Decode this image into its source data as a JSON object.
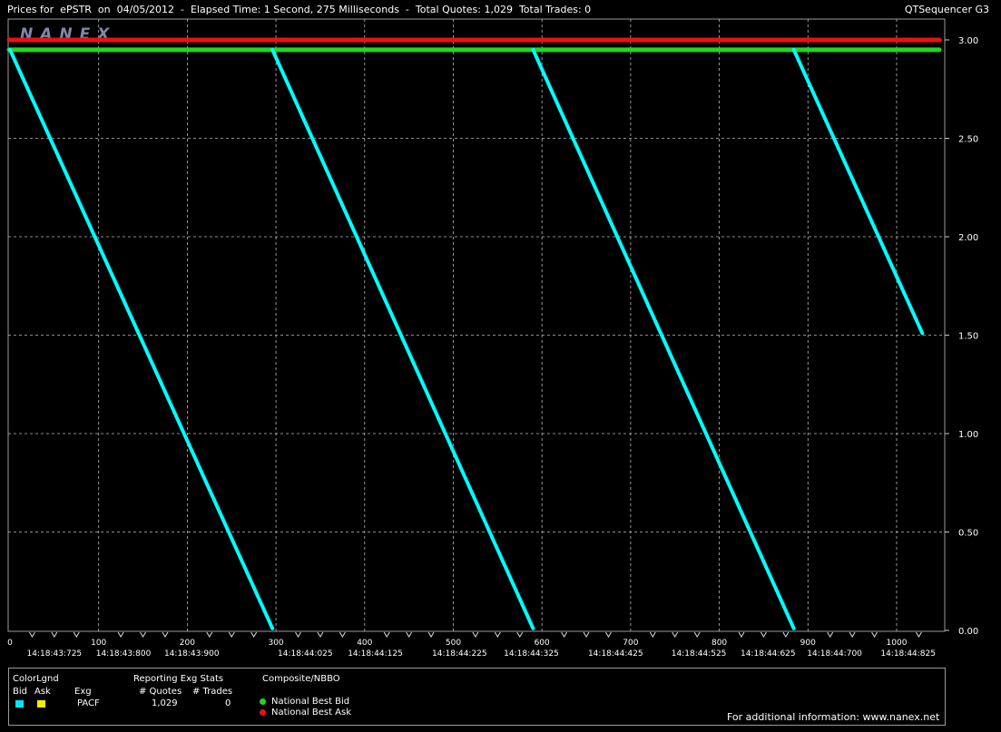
{
  "header": {
    "title": "Prices for  ePSTR  on  04/05/2012  -  Elapsed Time: 1 Second, 275 Milliseconds  -  Total Quotes: 1,029  Total Trades: 0",
    "app_name": "QTSequencer G3"
  },
  "watermark": "NANEX",
  "colors": {
    "bid": "#00e5f5",
    "ask": "#f2ee00",
    "nbbo_bid": "#1fd81f",
    "nbbo_ask": "#ee1010",
    "pacf_bid_line": "#00ffff",
    "grid": "#bbbbbb"
  },
  "chart_data": {
    "type": "line",
    "title": "",
    "xlabel": "",
    "ylabel": "",
    "xlim": [
      0,
      1029
    ],
    "ylim": [
      0,
      3.0
    ],
    "grid": true,
    "y_axis_side": "right",
    "y_ticks": [
      "0.00",
      "0.50",
      "1.00",
      "1.50",
      "2.00",
      "2.50",
      "3.00"
    ],
    "x_ticks": [
      "0",
      "100",
      "200",
      "300",
      "400",
      "500",
      "600",
      "700",
      "800",
      "900",
      "1000"
    ],
    "time_labels": [
      {
        "x": 50,
        "label": "14:18:43:725"
      },
      {
        "x": 128,
        "label": "14:18:43:800"
      },
      {
        "x": 205,
        "label": "14:18:43:900"
      },
      {
        "x": 333,
        "label": "14:18:44:025"
      },
      {
        "x": 412,
        "label": "14:18:44:125"
      },
      {
        "x": 507,
        "label": "14:18:44:225"
      },
      {
        "x": 588,
        "label": "14:18:44:325"
      },
      {
        "x": 683,
        "label": "14:18:44:425"
      },
      {
        "x": 777,
        "label": "14:18:44:525"
      },
      {
        "x": 855,
        "label": "14:18:44:625"
      },
      {
        "x": 930,
        "label": "14:18:44:700"
      },
      {
        "x": 1013,
        "label": "14:18:44:825"
      }
    ],
    "series": [
      {
        "name": "National Best Bid",
        "color": "#1fd81f",
        "x": [
          0,
          1029
        ],
        "y": [
          2.95,
          2.95
        ]
      },
      {
        "name": "National Best Ask",
        "color": "#ee1010",
        "x": [
          0,
          1029
        ],
        "y": [
          3.0,
          3.0
        ]
      },
      {
        "name": "PACF Bid",
        "color": "#00ffff",
        "segments": [
          {
            "x": [
              0,
              296
            ],
            "y": [
              2.95,
              0.01
            ]
          },
          {
            "x": [
              296,
              590
            ],
            "y": [
              2.95,
              0.01
            ]
          },
          {
            "x": [
              590,
              884
            ],
            "y": [
              2.95,
              0.01
            ]
          },
          {
            "x": [
              884,
              1029
            ],
            "y": [
              2.95,
              1.51
            ]
          }
        ]
      }
    ]
  },
  "legend": {
    "color_legend_label": "ColorLgnd",
    "bid_label": "Bid",
    "ask_label": "Ask",
    "exg_col": "Exg",
    "exg_value": "PACF",
    "stats_title": "Reporting Exg Stats",
    "quotes_col": "# Quotes",
    "trades_col": "# Trades",
    "quotes_value": "1,029",
    "trades_value": "0",
    "composite_title": "Composite/NBBO",
    "nbbo_bid_label": "National Best Bid",
    "nbbo_ask_label": "National Best Ask",
    "more_info": "For additional information: www.nanex.net"
  }
}
